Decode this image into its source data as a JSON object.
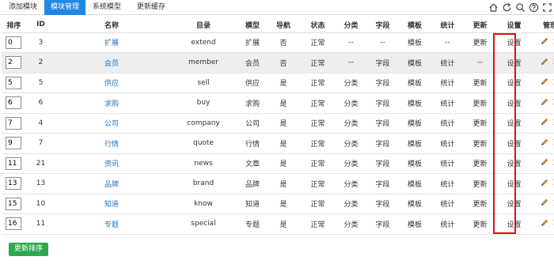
{
  "tabs": [
    {
      "label": "添加模块",
      "active": false
    },
    {
      "label": "模块管理",
      "active": true
    },
    {
      "label": "系统模型",
      "active": false
    },
    {
      "label": "更新缓存",
      "active": false
    }
  ],
  "toolbar_icons": [
    "home-icon",
    "refresh-icon",
    "search-icon",
    "help-icon",
    "fullscreen-icon"
  ],
  "table": {
    "headers": [
      "排序",
      "ID",
      "名称",
      "目录",
      "模型",
      "导航",
      "状态",
      "分类",
      "字段",
      "模板",
      "统计",
      "更新",
      "设置",
      "管理"
    ],
    "rows": [
      {
        "order": "0",
        "id": "3",
        "name": "扩展",
        "dir": "extend",
        "model": "扩展",
        "nav": "否",
        "status": "正常",
        "category": "--",
        "field": "--",
        "template": "模板",
        "stats": "--",
        "update": "更新",
        "settings": "设置"
      },
      {
        "order": "2",
        "id": "2",
        "name": "会员",
        "dir": "member",
        "model": "会员",
        "nav": "否",
        "status": "正常",
        "category": "--",
        "field": "字段",
        "template": "模板",
        "stats": "统计",
        "update": "--",
        "settings": "设置"
      },
      {
        "order": "5",
        "id": "5",
        "name": "供应",
        "dir": "sell",
        "model": "供应",
        "nav": "是",
        "status": "正常",
        "category": "分类",
        "field": "字段",
        "template": "模板",
        "stats": "统计",
        "update": "更新",
        "settings": "设置"
      },
      {
        "order": "6",
        "id": "6",
        "name": "求购",
        "dir": "buy",
        "model": "求购",
        "nav": "是",
        "status": "正常",
        "category": "分类",
        "field": "字段",
        "template": "模板",
        "stats": "统计",
        "update": "更新",
        "settings": "设置"
      },
      {
        "order": "7",
        "id": "4",
        "name": "公司",
        "dir": "company",
        "model": "公司",
        "nav": "是",
        "status": "正常",
        "category": "分类",
        "field": "字段",
        "template": "模板",
        "stats": "统计",
        "update": "更新",
        "settings": "设置"
      },
      {
        "order": "9",
        "id": "7",
        "name": "行情",
        "dir": "quote",
        "model": "行情",
        "nav": "是",
        "status": "正常",
        "category": "分类",
        "field": "字段",
        "template": "模板",
        "stats": "统计",
        "update": "更新",
        "settings": "设置"
      },
      {
        "order": "11",
        "id": "21",
        "name": "资讯",
        "dir": "news",
        "model": "文章",
        "nav": "是",
        "status": "正常",
        "category": "分类",
        "field": "字段",
        "template": "模板",
        "stats": "统计",
        "update": "更新",
        "settings": "设置"
      },
      {
        "order": "13",
        "id": "13",
        "name": "品牌",
        "dir": "brand",
        "model": "品牌",
        "nav": "是",
        "status": "正常",
        "category": "分类",
        "field": "字段",
        "template": "模板",
        "stats": "统计",
        "update": "更新",
        "settings": "设置"
      },
      {
        "order": "15",
        "id": "10",
        "name": "知道",
        "dir": "know",
        "model": "知道",
        "nav": "是",
        "status": "正常",
        "category": "分类",
        "field": "字段",
        "template": "模板",
        "stats": "统计",
        "update": "更新",
        "settings": "设置"
      },
      {
        "order": "16",
        "id": "11",
        "name": "专题",
        "dir": "special",
        "model": "专题",
        "nav": "是",
        "status": "正常",
        "category": "分类",
        "field": "字段",
        "template": "模板",
        "stats": "统计",
        "update": "更新",
        "settings": "设置"
      }
    ]
  },
  "colors": {
    "accent": "#1e88e5",
    "link": "#1e73be",
    "no": "#e00000",
    "yes": "#2a9d2a",
    "button": "#2fa84f",
    "highlight_box": "#e01010"
  },
  "update_order_button": "更新排序"
}
